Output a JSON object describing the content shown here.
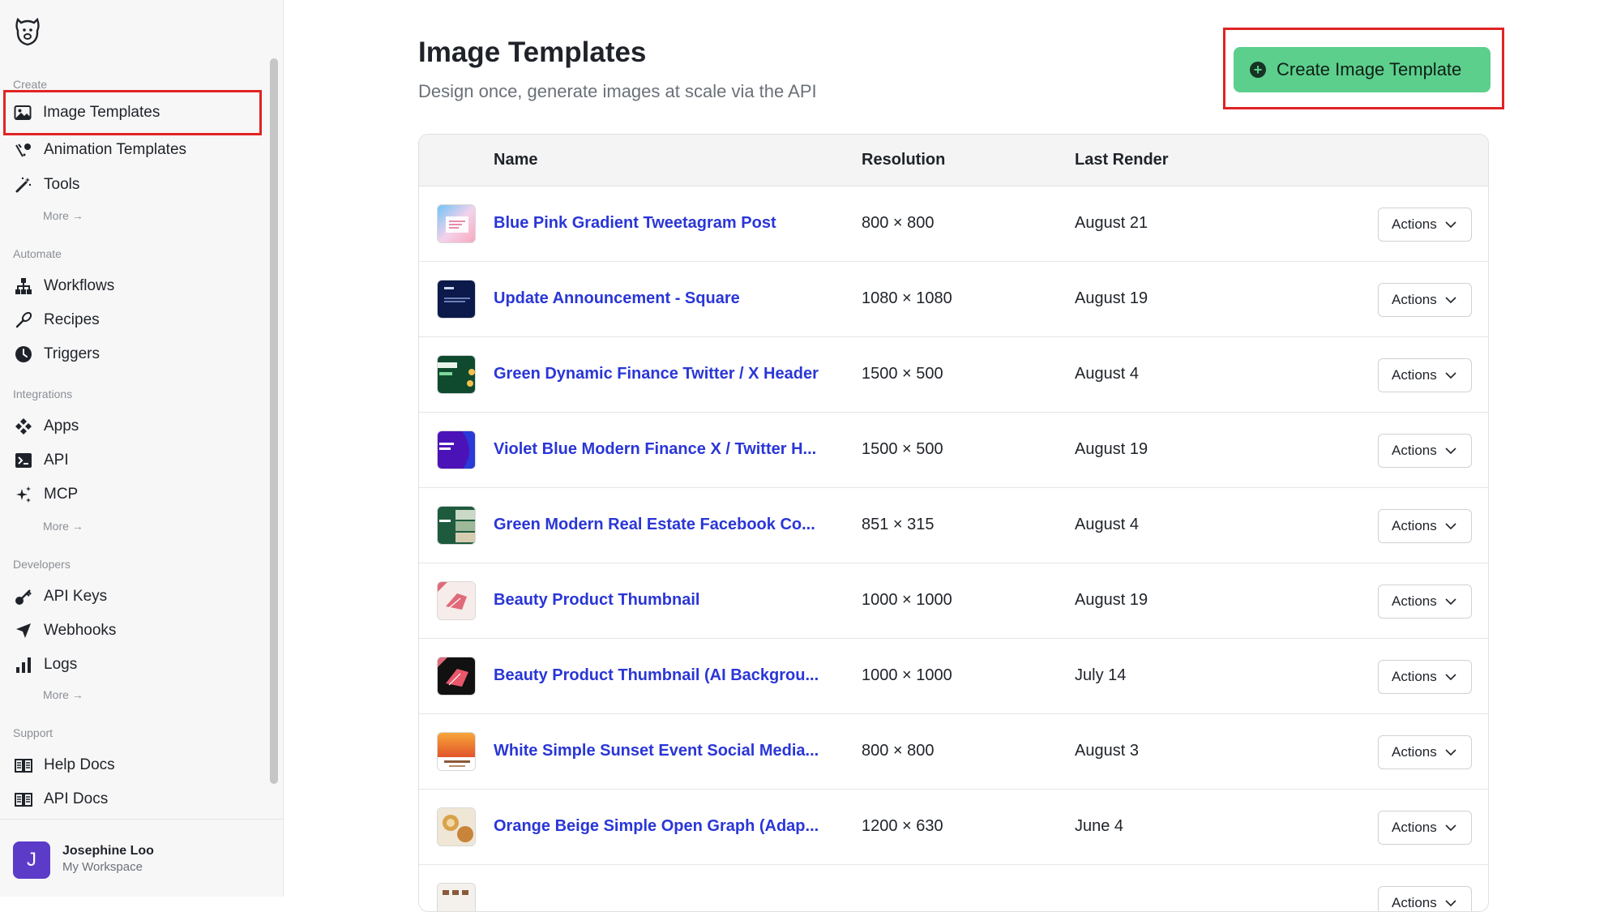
{
  "sidebar": {
    "sections": {
      "create": "Create",
      "automate": "Automate",
      "integrations": "Integrations",
      "developers": "Developers",
      "support": "Support"
    },
    "items": {
      "image_templates": "Image Templates",
      "animation_templates": "Animation Templates",
      "tools": "Tools",
      "workflows": "Workflows",
      "recipes": "Recipes",
      "triggers": "Triggers",
      "apps": "Apps",
      "api": "API",
      "mcp": "MCP",
      "api_keys": "API Keys",
      "webhooks": "Webhooks",
      "logs": "Logs",
      "help_docs": "Help Docs",
      "api_docs": "API Docs"
    },
    "more_label": "More →",
    "user": {
      "initial": "J",
      "name": "Josephine Loo",
      "workspace": "My Workspace"
    }
  },
  "header": {
    "title": "Image Templates",
    "subtitle": "Design once, generate images at scale via the API",
    "create_button": "Create Image Template"
  },
  "table": {
    "columns": [
      "Name",
      "Resolution",
      "Last Render"
    ],
    "action_label": "Actions",
    "rows": [
      {
        "name": "Blue Pink Gradient Tweetagram Post",
        "resolution": "800 × 800",
        "last_render": "August 21"
      },
      {
        "name": "Update Announcement - Square",
        "resolution": "1080 × 1080",
        "last_render": "August 19"
      },
      {
        "name": "Green Dynamic Finance Twitter / X Header",
        "resolution": "1500 × 500",
        "last_render": "August 4"
      },
      {
        "name": "Violet Blue Modern Finance X / Twitter H...",
        "resolution": "1500 × 500",
        "last_render": "August 19"
      },
      {
        "name": "Green Modern Real Estate Facebook Co...",
        "resolution": "851 × 315",
        "last_render": "August 4"
      },
      {
        "name": "Beauty Product Thumbnail",
        "resolution": "1000 × 1000",
        "last_render": "August 19"
      },
      {
        "name": "Beauty Product Thumbnail (AI Backgrou...",
        "resolution": "1000 × 1000",
        "last_render": "July 14"
      },
      {
        "name": "White Simple Sunset Event Social Media...",
        "resolution": "800 × 800",
        "last_render": "August 3"
      },
      {
        "name": "Orange Beige Simple Open Graph (Adap...",
        "resolution": "1200 × 630",
        "last_render": "June 4"
      },
      {
        "name": "",
        "resolution": "",
        "last_render": ""
      }
    ]
  },
  "colors": {
    "accent_green": "#5ccf8c",
    "link_blue": "#2a36d6",
    "highlight_red": "#e02424",
    "avatar_purple": "#5b3bc8"
  }
}
